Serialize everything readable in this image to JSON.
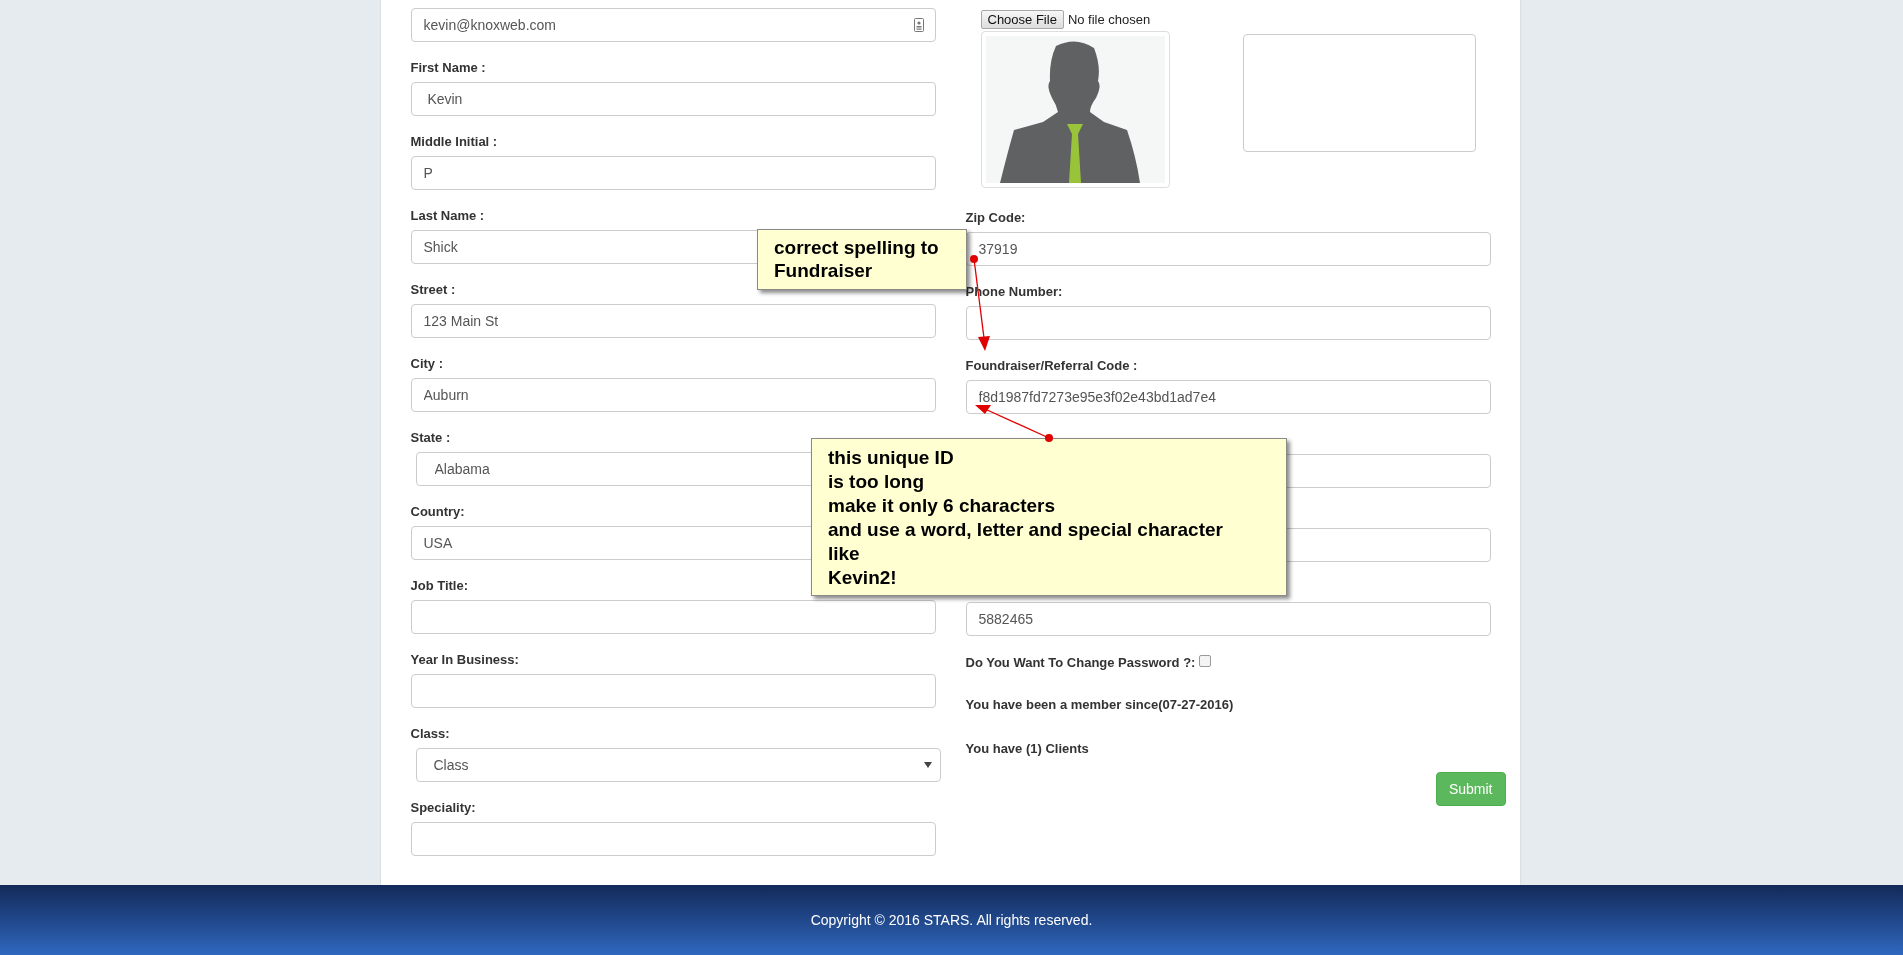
{
  "left_fields": [
    {
      "kind": "email",
      "value": "kevin@knoxweb.com"
    },
    {
      "kind": "text",
      "label": "First Name :",
      "value": " Kevin"
    },
    {
      "kind": "text",
      "label": "Middle Initial :",
      "value": "P"
    },
    {
      "kind": "text",
      "label": "Last Name :",
      "value": "Shick"
    },
    {
      "kind": "text",
      "label": "Street :",
      "value": "123 Main St"
    },
    {
      "kind": "text",
      "label": "City :",
      "value": "Auburn"
    },
    {
      "kind": "select",
      "label": "State :",
      "value": "Alabama"
    },
    {
      "kind": "text",
      "label": "Country:",
      "value": "USA"
    },
    {
      "kind": "text",
      "label": "Job Title:"
    },
    {
      "kind": "text",
      "label": "Year In Business:"
    },
    {
      "kind": "dropdown",
      "label": "Class:",
      "value": "Class"
    },
    {
      "kind": "text",
      "label": "Speciality:"
    }
  ],
  "upload": {
    "button": "Choose File",
    "status": "No file chosen"
  },
  "right_fields": [
    {
      "kind": "input",
      "label": "Zip Code:",
      "value": "37919"
    },
    {
      "kind": "input",
      "label": "Phone Number:"
    },
    {
      "kind": "input",
      "label": "Foundraiser/Referral Code :",
      "value": "f8d1987fd7273e95e3f02e43bd1ad7e4"
    },
    {
      "kind": "input"
    },
    {
      "kind": "input"
    },
    {
      "kind": "input",
      "value": "5882465"
    }
  ],
  "change_password": {
    "label": "Do You Want To Change Password ?:",
    "checked": false
  },
  "member_since": "You have been a member since(07-27-2016)",
  "clients": "You have (1) Clients",
  "submit": "Submit",
  "annotations": [
    {
      "text": "correct spelling to\nFundraiser"
    },
    {
      "text": "this unique ID\nis too long\nmake it only 6 characters\nand use a word, letter and special character\nlike\nKevin2!"
    }
  ],
  "footer": "Copyright © 2016 STARS. All rights reserved."
}
